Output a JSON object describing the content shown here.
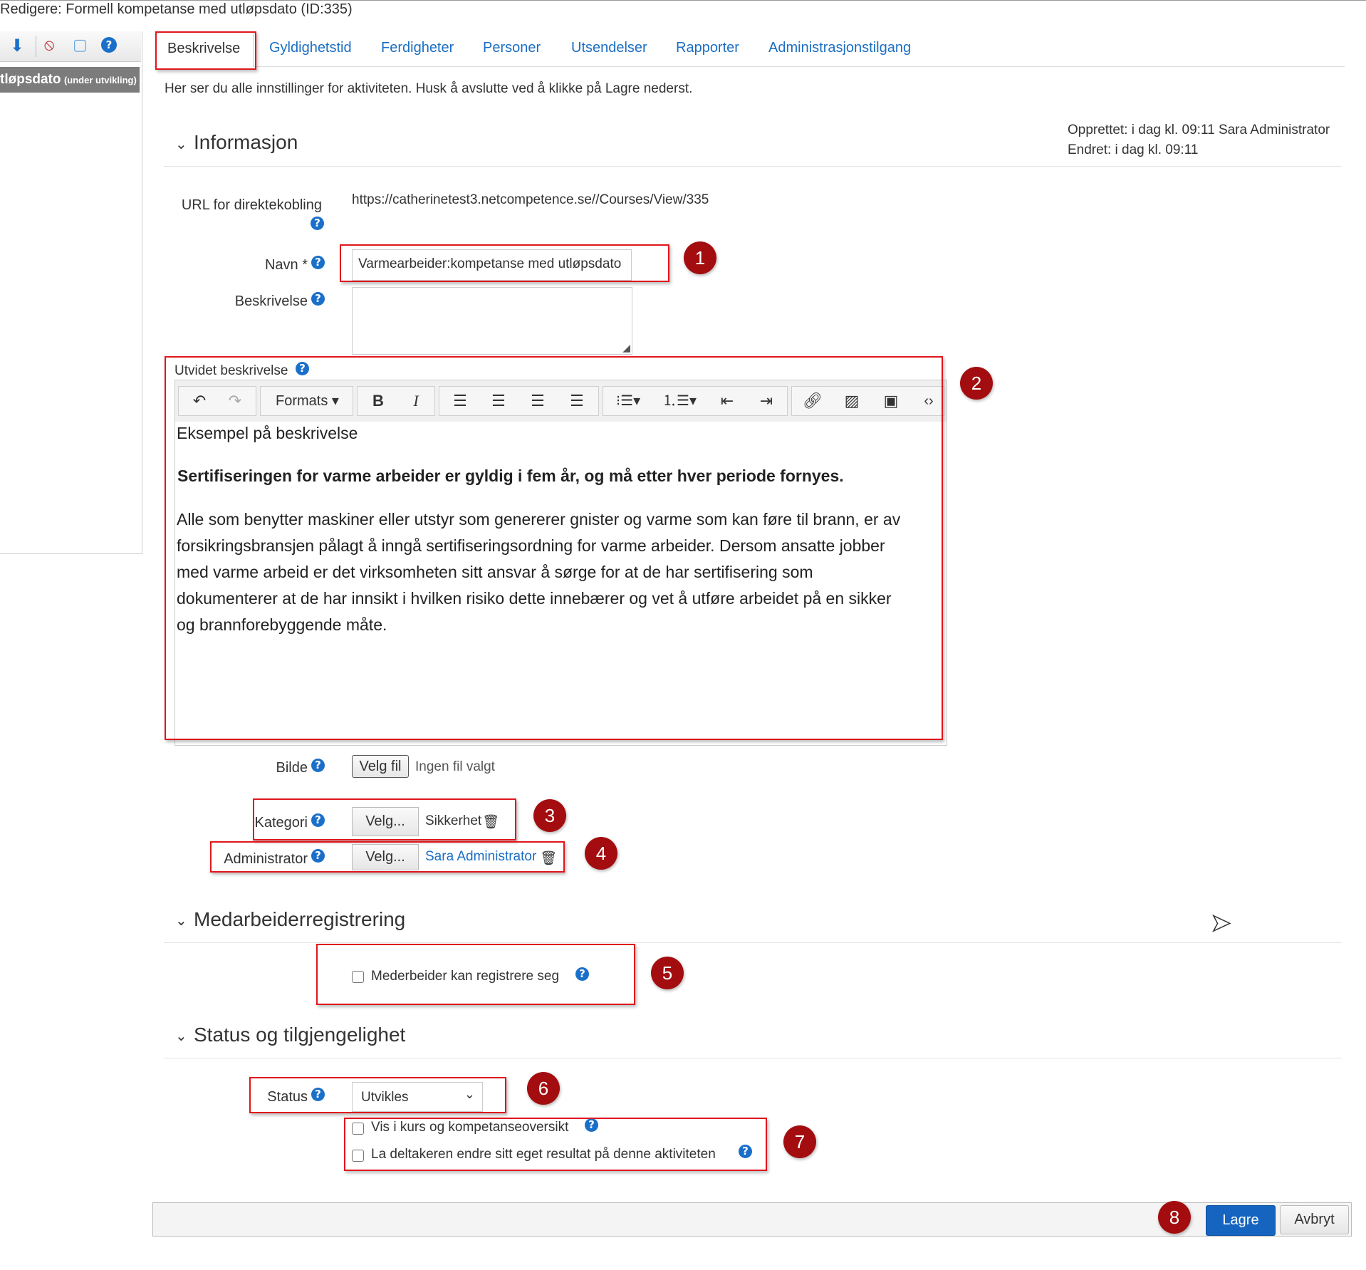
{
  "window_title": "Redigere: Formell kompetanse med utløpsdato (ID:335)",
  "sidebar": {
    "selected_item": "tløpsdato",
    "selected_item_status": "(under utvikling)",
    "help_icon": "?"
  },
  "tabs": [
    "Beskrivelse",
    "Gyldighetstid",
    "Ferdigheter",
    "Personer",
    "Utsendelser",
    "Rapporter",
    "Administrasjonstilgang"
  ],
  "intro_text": "Her ser du alle innstillinger for aktiviteten. Husk å avslutte ved å klikke på Lagre nederst.",
  "help_icon": "?",
  "info": {
    "section_title": "Informasjon",
    "created": "Opprettet: i dag kl. 09:11 Sara Administrator",
    "modified": "Endret: i dag kl. 09:11",
    "url_label": "URL for direktekobling",
    "url_value": "https://catherinetest3.netcompetence.se//Courses/View/335",
    "name_label": "Navn *",
    "name_value": "Varmearbeider:kompetanse med utløpsdato",
    "desc_label": "Beskrivelse",
    "desc_value": "",
    "ext_label": "Utvidet beskrivelse",
    "formats_label": "Formats",
    "editor_heading": "Eksempel på beskrivelse",
    "editor_bold": "Sertifiseringen for varme arbeider er gyldig i fem år, og må etter hver periode fornyes.",
    "editor_lines": [
      "Alle som benytter maskiner eller utstyr som genererer gnister og varme som kan føre til brann, er av",
      "forsikringsbransjen pålagt å inngå sertifiseringsordning for varme arbeider. Dersom ansatte jobber",
      "med varme arbeid er det virksomheten sitt ansvar å sørge for at de har sertifisering som",
      "dokumenterer at de har innsikt i hvilken risiko dette innebærer og vet å utføre arbeidet på en sikker",
      "og brannforebyggende måte."
    ],
    "image_label": "Bilde",
    "choose_file_label": "Velg fil",
    "no_file_text": "Ingen fil valgt",
    "category_label": "Kategori",
    "category_button": "Velg...",
    "category_value": "Sikkerhet",
    "admin_label": "Administrator",
    "admin_button": "Velg...",
    "admin_value": "Sara Administrator"
  },
  "registration": {
    "section_title": "Medarbeiderregistrering",
    "checkbox_label": "Mederbeider kan registrere seg",
    "checked": false
  },
  "status": {
    "section_title": "Status og tilgjengelighet",
    "status_label": "Status",
    "status_value": "Utvikles",
    "show_in_overview_label": "Vis i kurs og kompetanseoversikt",
    "allow_edit_result_label": "La deltakeren endre sitt eget resultat på denne aktiviteten"
  },
  "footer": {
    "save_label": "Lagre",
    "cancel_label": "Avbryt"
  },
  "annotations": [
    "1",
    "2",
    "3",
    "4",
    "5",
    "6",
    "7",
    "8"
  ],
  "colors": {
    "annotation_red": "#e0161c",
    "badge_red": "#a30d10",
    "link_blue": "#1b6ec2",
    "primary_button": "#1565c0"
  }
}
